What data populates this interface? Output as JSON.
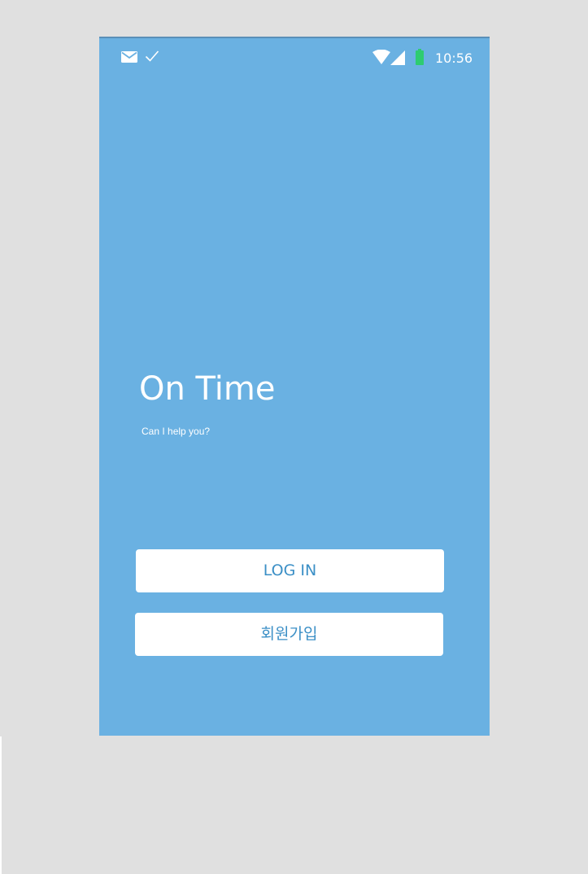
{
  "status_bar": {
    "time": "10:56",
    "icons": [
      "mail-icon",
      "check-icon",
      "wifi-icon",
      "signal-icon",
      "battery-icon"
    ]
  },
  "app": {
    "title": "On Time",
    "subtitle": "Can I help you?"
  },
  "buttons": {
    "login_label": "LOG IN",
    "signup_label": "회원가입"
  },
  "colors": {
    "background": "#6ab1e2",
    "button_bg": "#ffffff",
    "button_text": "#3b8fc6",
    "battery": "#2ecc71",
    "outer_bg": "#e0e0e0"
  }
}
